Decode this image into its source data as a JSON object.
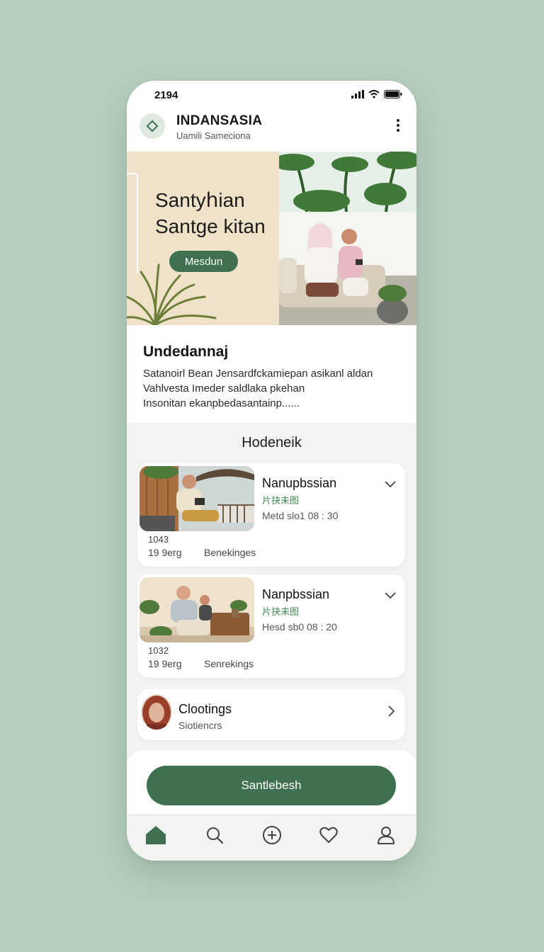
{
  "status": {
    "time": "2194"
  },
  "app": {
    "title": "INDANSASIA",
    "subtitle": "Uamili Sameciona"
  },
  "hero": {
    "title_line1": "Santyհian",
    "title_line2": "Santge kitan",
    "button_label": "Mesdun"
  },
  "intro": {
    "heading": "Undedannaj",
    "lines": [
      "Satanoirl Bean Jensardfckamiepan asikanl aldan",
      "Vahlvesta Imeder saldlaka pkehan",
      "Insonitan ekanpbedasantainp......"
    ]
  },
  "section": {
    "title": "Hodeneik"
  },
  "listings": [
    {
      "name": "Nanupbssian",
      "tag": "片抉未图",
      "meta": "Metd slo1 08 : 30",
      "number": "1043",
      "date": "19 9erg",
      "extra": "Benekinges"
    },
    {
      "name": "Nanpbssian",
      "tag": "片抉未图",
      "meta": "Hesd sb0 08 : 20",
      "number": "1032",
      "date": "19 9erg",
      "extra": "Senrekings"
    }
  ],
  "contact": {
    "name": "Clootings",
    "subtitle": "Siotiencrs"
  },
  "cta": {
    "label": "Santlebesh"
  },
  "nav": [
    "home-icon",
    "search-icon",
    "add-icon",
    "heart-icon",
    "profile-icon"
  ],
  "colors": {
    "accent": "#3f7150",
    "tag_green": "#3f8a53",
    "background": "#b7cdbd"
  }
}
